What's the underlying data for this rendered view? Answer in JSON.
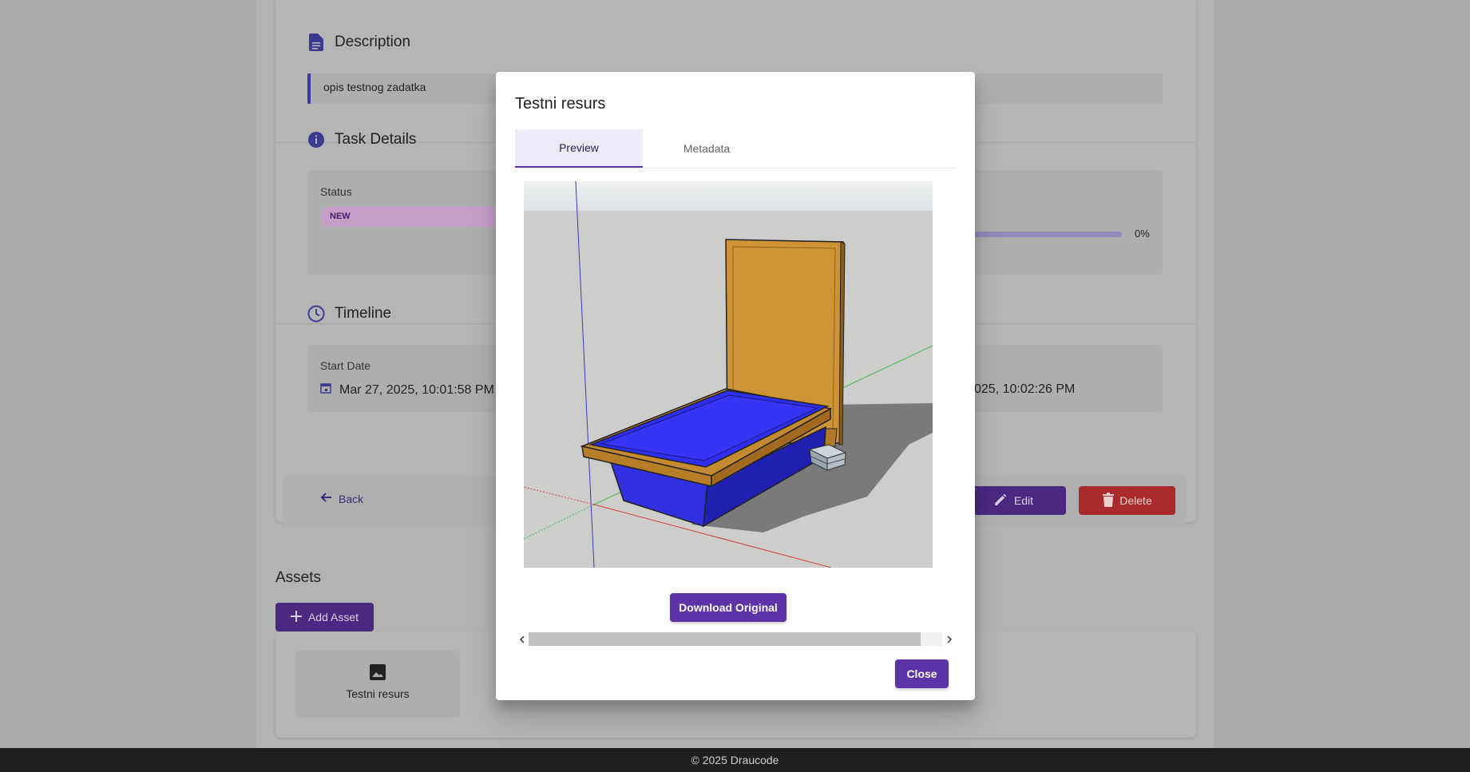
{
  "task": {
    "description_heading": "Description",
    "description_text": "opis testnog zadatka",
    "details_heading": "Task Details",
    "status_label": "Status",
    "status_value": "NEW",
    "progress_percent_text": "0%",
    "progress_value": 0,
    "timeline_heading": "Timeline",
    "start_date_label": "Start Date",
    "start_date_value": "Mar 27, 2025, 10:01:58 PM",
    "end_date_value_partial": "025, 10:02:26 PM",
    "back_label": "Back",
    "edit_label": "Edit",
    "delete_label": "Delete"
  },
  "assets": {
    "heading": "Assets",
    "add_label": "Add Asset",
    "items": [
      {
        "name": "Testni resurs",
        "icon": "image-icon"
      }
    ]
  },
  "modal": {
    "title": "Testni resurs",
    "tabs": [
      {
        "label": "Preview",
        "active": true
      },
      {
        "label": "Metadata",
        "active": false
      }
    ],
    "download_label": "Download Original",
    "close_label": "Close"
  },
  "footer": {
    "text": "© 2025 Draucode"
  },
  "colors": {
    "primary": "#5b34a8",
    "danger": "#d32f2f",
    "tab_active_bg": "#efeaf8",
    "footer_bg": "#1f1f1f"
  }
}
